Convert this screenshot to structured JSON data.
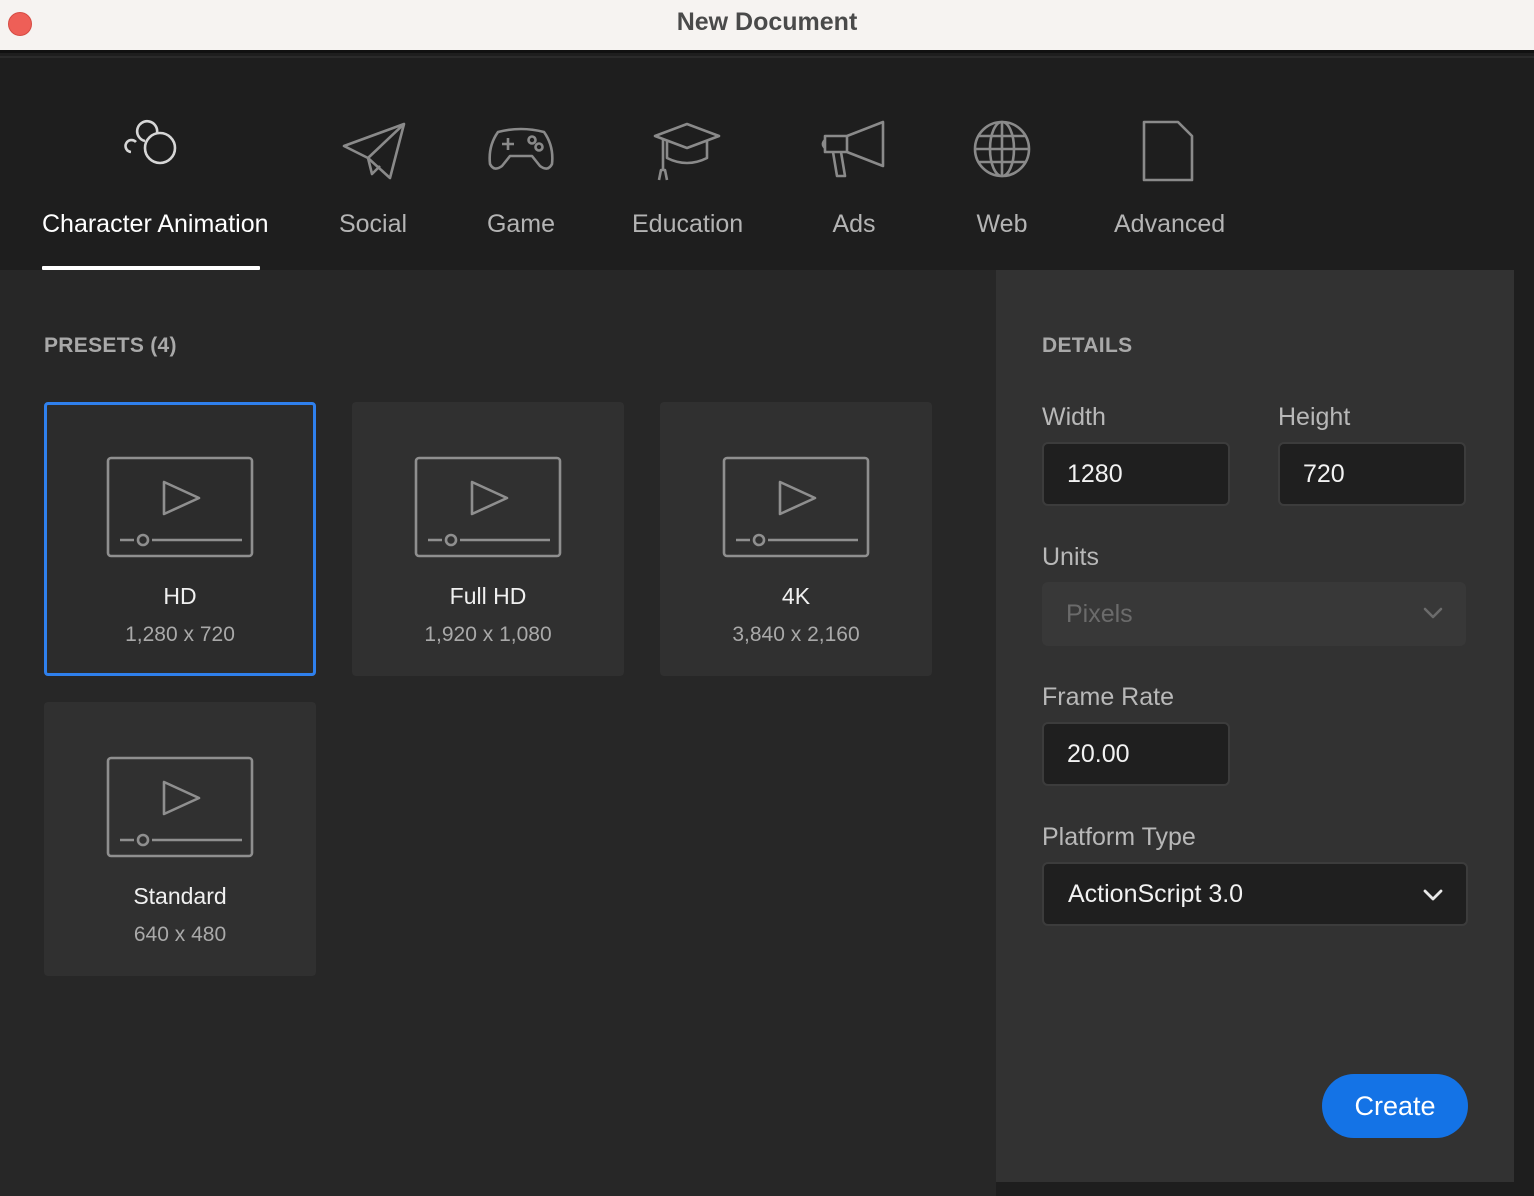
{
  "window": {
    "title": "New Document"
  },
  "categories": [
    {
      "label": "Character Animation",
      "icon": "character-animation-icon",
      "active": true
    },
    {
      "label": "Social",
      "icon": "paper-plane-icon"
    },
    {
      "label": "Game",
      "icon": "gamepad-icon"
    },
    {
      "label": "Education",
      "icon": "graduation-cap-icon"
    },
    {
      "label": "Ads",
      "icon": "megaphone-icon"
    },
    {
      "label": "Web",
      "icon": "globe-icon"
    },
    {
      "label": "Advanced",
      "icon": "document-icon"
    }
  ],
  "presets": {
    "title": "PRESETS (4)",
    "items": [
      {
        "name": "HD",
        "size": "1,280 x 720",
        "selected": true
      },
      {
        "name": "Full HD",
        "size": "1,920 x 1,080"
      },
      {
        "name": "4K",
        "size": "3,840 x 2,160"
      },
      {
        "name": "Standard",
        "size": "640 x 480"
      }
    ]
  },
  "details": {
    "title": "DETAILS",
    "width_label": "Width",
    "width_value": "1280",
    "height_label": "Height",
    "height_value": "720",
    "units_label": "Units",
    "units_value": "Pixels",
    "frame_rate_label": "Frame Rate",
    "frame_rate_value": "20.00",
    "platform_label": "Platform Type",
    "platform_value": "ActionScript 3.0"
  },
  "actions": {
    "create_label": "Create"
  },
  "colors": {
    "accent": "#1473e6",
    "selection": "#2f80ed",
    "background": "#1e1e1e"
  }
}
